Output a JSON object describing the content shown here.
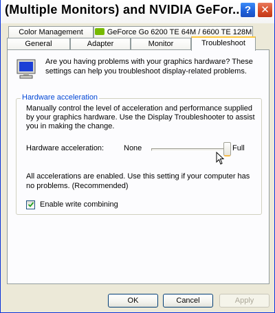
{
  "window": {
    "title": "(Multiple Monitors) and NVIDIA GeFor...",
    "help_glyph": "?",
    "close_glyph": "✕"
  },
  "tabs": {
    "row1": [
      {
        "label": "Color Management"
      },
      {
        "label": "GeForce Go 6200 TE 64M / 6600 TE 128M",
        "icon": "nvidia-logo-icon"
      }
    ],
    "row2": [
      {
        "label": "General"
      },
      {
        "label": "Adapter"
      },
      {
        "label": "Monitor"
      },
      {
        "label": "Troubleshoot",
        "active": true
      }
    ]
  },
  "panel": {
    "intro": "Are you having problems with your graphics hardware? These settings can help you troubleshoot display-related problems.",
    "group": {
      "legend": "Hardware acceleration",
      "description": "Manually control the level of acceleration and performance supplied by your graphics hardware. Use the Display Troubleshooter to assist you in making the change.",
      "slider": {
        "label": "Hardware acceleration:",
        "min_label": "None",
        "max_label": "Full",
        "level": 1.0
      },
      "status": "All accelerations are enabled. Use this setting if your computer has no problems. (Recommended)",
      "checkbox": {
        "label": "Enable write combining",
        "checked": true
      }
    }
  },
  "buttons": {
    "ok": "OK",
    "cancel": "Cancel",
    "apply": "Apply"
  },
  "colors": {
    "accent": "#0046d5",
    "active_tab_highlight": "#ffc83c",
    "close_button": "#d64a24",
    "help_button": "#1d5fd9"
  }
}
